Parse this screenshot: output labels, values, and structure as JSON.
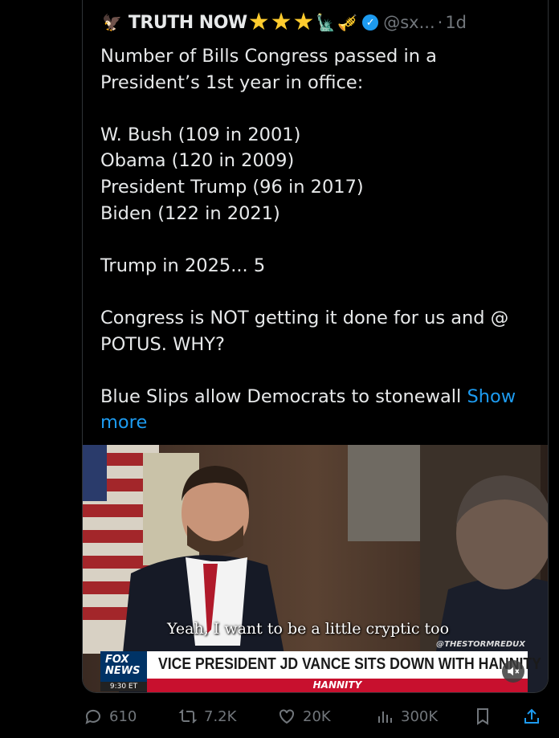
{
  "post": {
    "display_name": "TRUTH NOW",
    "handle": "@sx...",
    "separator": "·",
    "time": "1d",
    "text_lines": [
      "Number of Bills Congress passed in a",
      "President’s 1st year in office:",
      "",
      "W. Bush (109 in 2001)",
      "Obama (120 in 2009)",
      "President Trump (96 in 2017)",
      "Biden (122 in 2021)",
      "",
      "Trump in 2025... 5",
      "",
      "Congress is NOT getting it done for us and @",
      "POTUS.  WHY?",
      "",
      "Blue Slips allow Democrats to stonewall"
    ],
    "show_more": "Show",
    "show_more_2": "more"
  },
  "video": {
    "subtitle": "Yeah, I want to be a little cryptic too",
    "watermark": "@THESTORMREDUX",
    "chyron": "VICE PRESIDENT JD VANCE SITS DOWN WITH HANNITY",
    "network_logo_line1": "FOX",
    "network_logo_line2": "NEWS",
    "airtime": "9:30 ET",
    "show_name": "HANNITY"
  },
  "actions": {
    "replies": "610",
    "reposts": "7.2K",
    "likes": "20K",
    "views": "300K"
  },
  "colors": {
    "accent": "#1d9bf0",
    "muted": "#71767b",
    "text": "#e7e9ea",
    "star": "#ffcc2e"
  }
}
